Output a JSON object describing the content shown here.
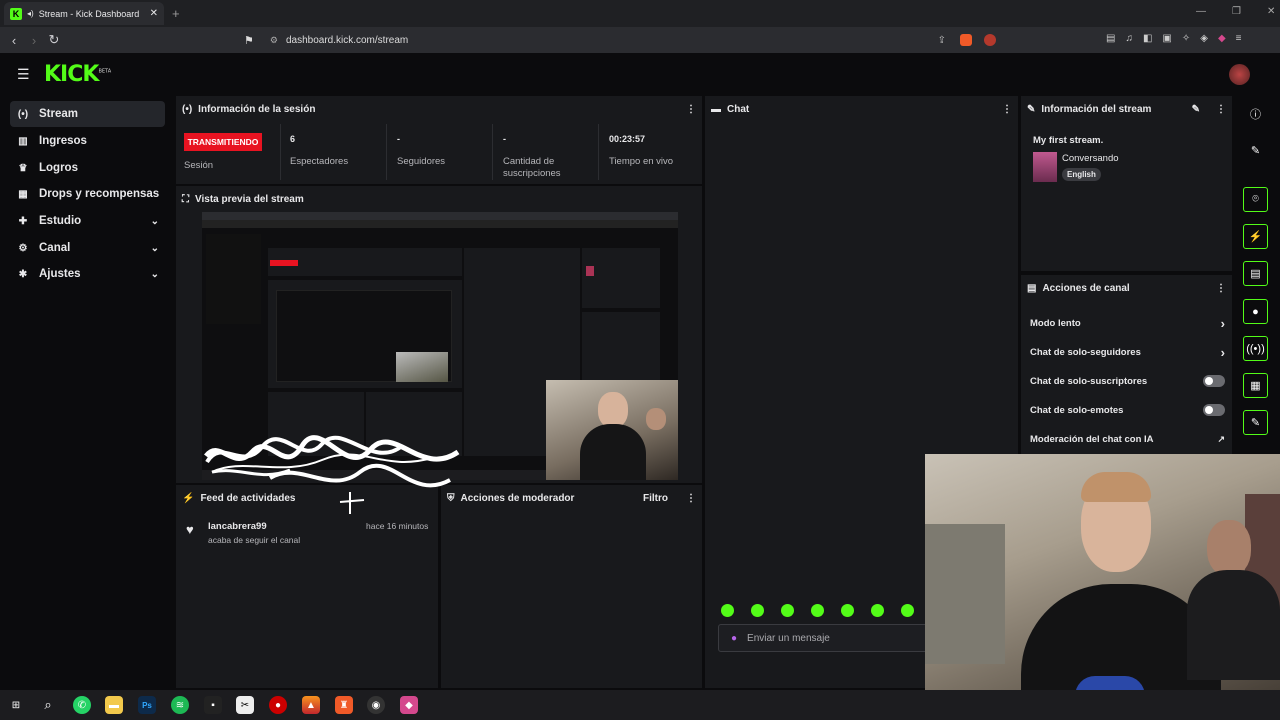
{
  "browser": {
    "tab_title": "Stream - Kick Dashboard",
    "url": "dashboard.kick.com/stream"
  },
  "header": {
    "logo": "KICK",
    "logo_badge": "BETA"
  },
  "sidebar": {
    "items": [
      {
        "label": "Stream",
        "icon": "broadcast-icon"
      },
      {
        "label": "Ingresos",
        "icon": "revenue-icon"
      },
      {
        "label": "Logros",
        "icon": "trophy-icon"
      },
      {
        "label": "Drops y recompensas",
        "icon": "gift-icon"
      },
      {
        "label": "Estudio",
        "icon": "studio-icon"
      },
      {
        "label": "Canal",
        "icon": "channel-icon"
      },
      {
        "label": "Ajustes",
        "icon": "gear-icon"
      }
    ]
  },
  "session": {
    "title": "Información de la sesión",
    "status": "TRANSMITIENDO",
    "status_label": "Sesión",
    "stats": [
      {
        "value": "6",
        "label": "Espectadores"
      },
      {
        "value": "-",
        "label": "Seguidores"
      },
      {
        "value": "-",
        "label": "Cantidad de suscripciones"
      },
      {
        "value": "00:23:57",
        "label": "Tiempo en vivo"
      }
    ]
  },
  "preview": {
    "title": "Vista previa del stream"
  },
  "activity": {
    "title": "Feed de actividades",
    "user": "lancabrera99",
    "time": "hace 16 minutos",
    "action": "acaba de seguir el canal"
  },
  "mod": {
    "title": "Acciones de moderador",
    "filter": "Filtro"
  },
  "chat": {
    "title": "Chat",
    "placeholder": "Enviar un mensaje"
  },
  "stream_info": {
    "title": "Información del stream",
    "stream_title": "My first stream.",
    "category": "Conversando",
    "language": "English"
  },
  "channel_actions": {
    "title": "Acciones de canal",
    "items": [
      {
        "label": "Modo lento",
        "control": "chevron"
      },
      {
        "label": "Chat de solo-seguidores",
        "control": "chevron"
      },
      {
        "label": "Chat de solo-suscriptores",
        "control": "toggle"
      },
      {
        "label": "Chat de solo-emotes",
        "control": "toggle"
      },
      {
        "label": "Moderación del chat con IA",
        "control": "external"
      }
    ]
  },
  "colors": {
    "accent": "#53fc18",
    "live": "#e81321",
    "panel": "#18191c"
  }
}
